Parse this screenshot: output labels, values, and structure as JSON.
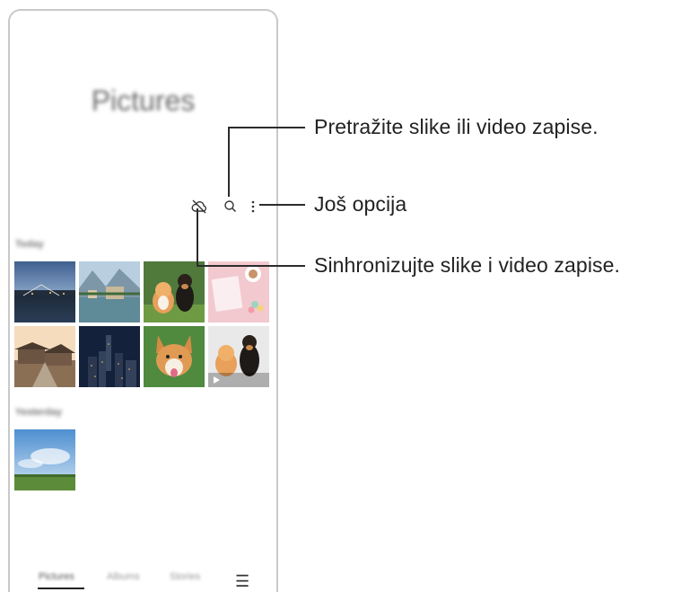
{
  "screen": {
    "title": "Pictures",
    "sections": [
      {
        "label": "Today",
        "thumbnails": [
          "bridge-city-night",
          "lakeside-village",
          "kitten-and-dog",
          "pink-notebook-coffee",
          "village-sunset",
          "city-skyline-night",
          "corgi-on-grass",
          "kitten-and-dog-video"
        ]
      },
      {
        "label": "Yesterday",
        "thumbnails": [
          "sky-and-field"
        ]
      }
    ],
    "toolbar": {
      "sync_icon": "cloud-off-icon",
      "search_icon": "search-icon",
      "more_icon": "more-vertical-icon"
    },
    "bottom_nav": {
      "items": [
        "Pictures",
        "Albums",
        "Stories"
      ],
      "menu_icon": "menu-icon",
      "active": "Pictures"
    }
  },
  "callouts": {
    "search": "Pretražite slike ili video zapise.",
    "more": "Još opcija",
    "sync": "Sinhronizujte slike i video zapise."
  }
}
